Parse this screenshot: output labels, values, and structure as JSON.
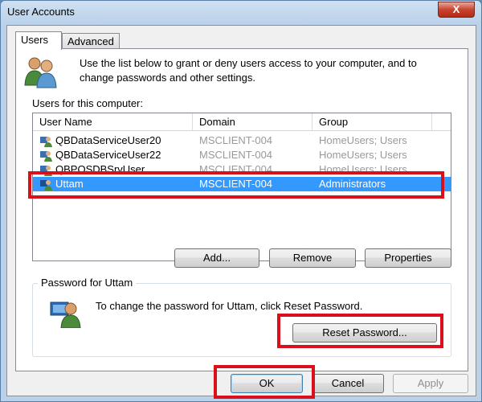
{
  "window": {
    "title": "User Accounts",
    "close_glyph": "X"
  },
  "tabs": [
    {
      "label": "Users"
    },
    {
      "label": "Advanced"
    }
  ],
  "intro": {
    "text": "Use the list below to grant or deny users access to your computer, and to change passwords and other settings."
  },
  "users_list": {
    "label": "Users for this computer:",
    "columns": [
      "User Name",
      "Domain",
      "Group"
    ],
    "rows": [
      {
        "name": "QBDataServiceUser20",
        "domain": "MSCLIENT-004",
        "group": "HomeUsers; Users"
      },
      {
        "name": "QBDataServiceUser22",
        "domain": "MSCLIENT-004",
        "group": "HomeUsers; Users"
      },
      {
        "name": "QBPOSDBSrvUser",
        "domain": "MSCLIENT-004",
        "group": "HomeUsers; Users"
      },
      {
        "name": "Uttam",
        "domain": "MSCLIENT-004",
        "group": "Administrators",
        "selected": true
      }
    ]
  },
  "list_buttons": {
    "add": "Add...",
    "remove": "Remove",
    "properties": "Properties"
  },
  "password": {
    "group_label": "Password for Uttam",
    "text": "To change the password for Uttam, click Reset Password.",
    "reset_button": "Reset Password..."
  },
  "footer": {
    "ok": "OK",
    "cancel": "Cancel",
    "apply": "Apply"
  },
  "colors": {
    "highlight": "#d9101a",
    "selection": "#3399ff"
  }
}
